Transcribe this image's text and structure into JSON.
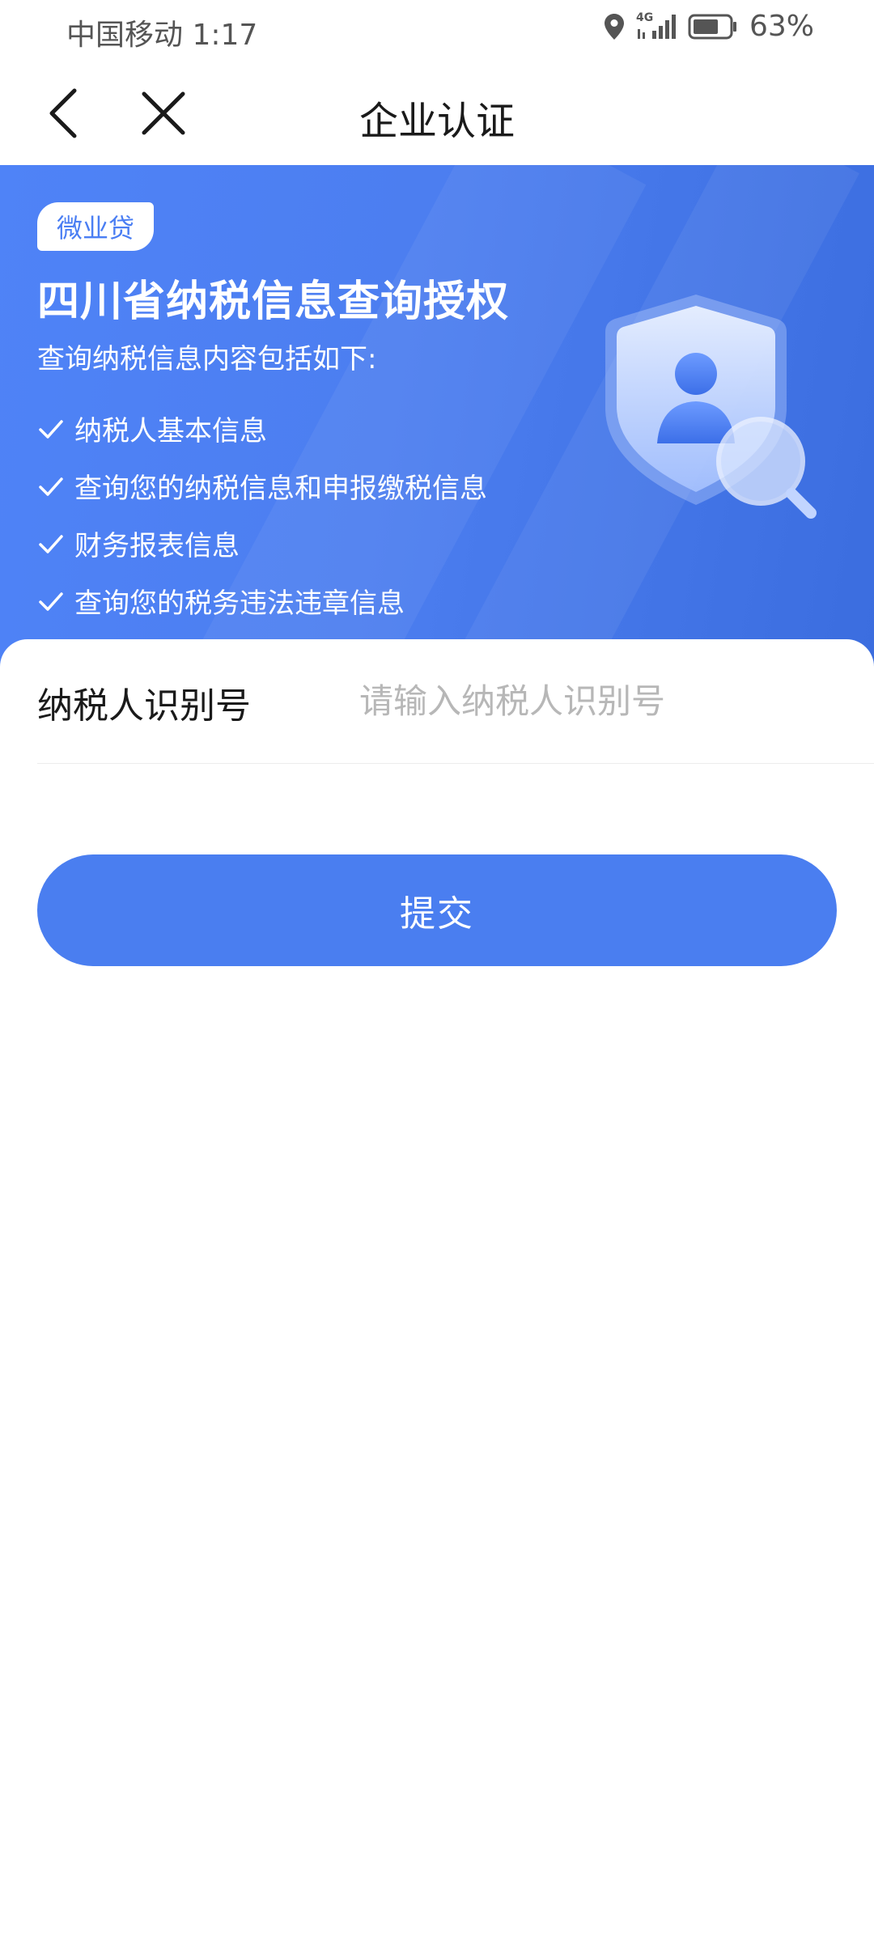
{
  "status_bar": {
    "carrier_time": "中国移动 1:17",
    "network": "4G",
    "battery": "63%"
  },
  "header": {
    "title": "企业认证",
    "back_icon": "chevron-left-icon",
    "close_icon": "close-icon"
  },
  "banner": {
    "tag": "微业贷",
    "title": "四川省纳税信息查询授权",
    "subtitle": "查询纳税信息内容包括如下:",
    "items": [
      "纳税人基本信息",
      "查询您的纳税信息和申报缴税信息",
      "财务报表信息",
      "查询您的税务违法违章信息"
    ],
    "accent_color": "#4c7ef0"
  },
  "form": {
    "label": "纳税人识别号",
    "placeholder": "请输入纳税人识别号",
    "value": ""
  },
  "submit": {
    "label": "提交",
    "color": "#4a7ef0"
  }
}
